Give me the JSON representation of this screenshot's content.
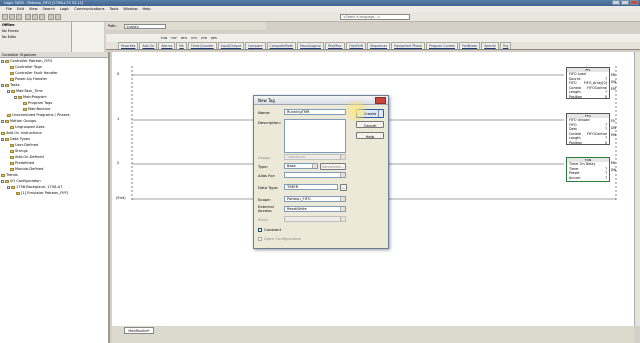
{
  "window": {
    "title": "Logix 5000 - Patreon_FIFO [1756-L73 33.11]"
  },
  "menu": [
    "File",
    "Edit",
    "View",
    "Search",
    "Logic",
    "Communications",
    "Tools",
    "Window",
    "Help"
  ],
  "toolbar": {
    "language_placeholder": "<Select a language...>"
  },
  "status_panel": {
    "rows": [
      {
        "label": "Offline",
        "value": ""
      },
      {
        "label": "No Forces",
        "value": ""
      },
      {
        "label": "No Edits",
        "value": ""
      }
    ]
  },
  "path": {
    "label": "Path:",
    "value": "<none>"
  },
  "instruction_tabs": [
    "Favorites",
    "Add-On",
    "Alarms",
    "Bit",
    "Timer/Counter",
    "Input/Output",
    "Compare",
    "Compute/Math",
    "Move/Logical",
    "File/Misc.",
    "File/Shift",
    "Sequencer",
    "Equipment Phase",
    "Program Control",
    "For/Break",
    "Special",
    "Trig"
  ],
  "instruction_icons": [
    "TON",
    "TOF",
    "RTO",
    "CTU",
    "CTD",
    "RES"
  ],
  "organizer": {
    "title": "Controller Organizer",
    "items": [
      {
        "label": "Controller Patreon_FIFO",
        "level": 0
      },
      {
        "label": "Controller Tags",
        "level": 1
      },
      {
        "label": "Controller Fault Handler",
        "level": 1
      },
      {
        "label": "Power-Up Handler",
        "level": 1
      },
      {
        "label": "Tasks",
        "level": 0
      },
      {
        "label": "MainTask_Tims",
        "level": 1
      },
      {
        "label": "MainProgram",
        "level": 2
      },
      {
        "label": "Program Tags",
        "level": 3
      },
      {
        "label": "MainRoutine",
        "level": 3
      },
      {
        "label": "Unscheduled Programs / Phases",
        "level": 1
      },
      {
        "label": "Motion Groups",
        "level": 0
      },
      {
        "label": "Ungrouped Axes",
        "level": 1
      },
      {
        "label": "Add-On Instructions",
        "level": 0
      },
      {
        "label": "Data Types",
        "level": 0
      },
      {
        "label": "User-Defined",
        "level": 1
      },
      {
        "label": "Strings",
        "level": 1
      },
      {
        "label": "Add-On-Defined",
        "level": 1
      },
      {
        "label": "Predefined",
        "level": 1
      },
      {
        "label": "Module-Defined",
        "level": 1
      },
      {
        "label": "Trends",
        "level": 0
      },
      {
        "label": "I/O Configuration",
        "level": 0
      },
      {
        "label": "1756 Backplane, 1756-A7",
        "level": 1
      },
      {
        "label": "[1] Emulator Patreon_FIFO",
        "level": 2
      }
    ]
  },
  "ladder": {
    "rung_numbers": [
      "0",
      "1",
      "2",
      "(End)"
    ],
    "routine_tab": "MainRoutine*",
    "ffl": {
      "header": "FFL",
      "rows": [
        {
          "k": "FIFO Load",
          "v": ""
        },
        {
          "k": "Source",
          "v": "?"
        },
        {
          "k": "FIFO",
          "v": "FIFO_Array[0]"
        },
        {
          "k": "Control",
          "v": "FIFOControl"
        },
        {
          "k": "Length",
          "v": "?"
        },
        {
          "k": "Position",
          "v": "0"
        }
      ],
      "coils": [
        "EN",
        "DN",
        "EM"
      ]
    },
    "ffu": {
      "header": "FFU",
      "rows": [
        {
          "k": "FIFO Unload",
          "v": ""
        },
        {
          "k": "FIFO",
          "v": "?"
        },
        {
          "k": "Dest",
          "v": "?"
        },
        {
          "k": "Control",
          "v": "FIFOControl"
        },
        {
          "k": "Length",
          "v": "?"
        },
        {
          "k": "Position",
          "v": "0"
        }
      ],
      "coils": [
        "EU",
        "DN",
        "EM"
      ]
    },
    "ton": {
      "header": "TON",
      "rows": [
        {
          "k": "Timer On Delay",
          "v": ""
        },
        {
          "k": "Timer",
          "v": "?"
        },
        {
          "k": "Preset",
          "v": "?"
        },
        {
          "k": "Accum",
          "v": "?"
        }
      ],
      "coils": [
        "EN",
        "DN"
      ]
    }
  },
  "dialog": {
    "title": "New Tag",
    "name_label": "Name:",
    "name_value": "RunningTMR",
    "description_label": "Description:",
    "usage_label": "Usage:",
    "usage_value": "<normal>",
    "type_label": "Type:",
    "type_value": "Base",
    "connection_button": "Connection...",
    "alias_label": "Alias For:",
    "datatype_label": "Data Type:",
    "datatype_value": "TIMER",
    "datatype_browse": "...",
    "scope_label": "Scope:",
    "scope_value": "Patreon_FIFO",
    "external_label": "External Access:",
    "external_value": "Read/Write",
    "style_label": "Style:",
    "constant_label": "Constant",
    "open_config_label": "Open Configuration",
    "create_button": "Create",
    "cancel_button": "Cancel",
    "help_button": "Help"
  }
}
